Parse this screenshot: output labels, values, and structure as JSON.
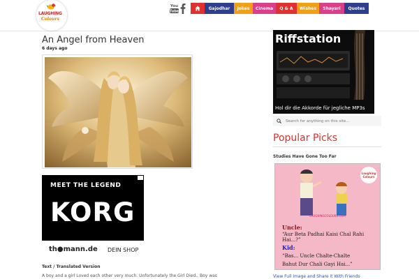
{
  "header": {
    "logo": {
      "line1": "LAUGHING",
      "line2": "Colours"
    },
    "social": [
      {
        "name": "youtube-icon",
        "text": "You Tube"
      },
      {
        "name": "facebook-icon",
        "text": "f"
      }
    ],
    "nav": [
      {
        "id": "home",
        "label": "",
        "color": "#e03030",
        "icon": "home-icon"
      },
      {
        "id": "gajodhar",
        "label": "Gajodhar",
        "color": "#2f3d8f"
      },
      {
        "id": "jokes",
        "label": "Jokes",
        "color": "#f0a016"
      },
      {
        "id": "cinema",
        "label": "Cinema",
        "color": "#d94088"
      },
      {
        "id": "qa",
        "label": "Q & A",
        "color": "#e03030"
      },
      {
        "id": "wishes",
        "label": "Wishes",
        "color": "#f0a016"
      },
      {
        "id": "shayari",
        "label": "Shayari",
        "color": "#d94088"
      },
      {
        "id": "quotes",
        "label": "Quotes",
        "color": "#2f3d8f"
      }
    ]
  },
  "post": {
    "title": "An Angel from Heaven",
    "date": "6 days ago",
    "section_label": "Text / Translated Version",
    "body_preview": "A boy and a girl Loved each other very much. Unfortunately the Girl Died.. Boy was"
  },
  "ad_korg": {
    "line1": "MEET THE LEGEND",
    "brand": "KORG",
    "store": "th●mann.de",
    "cta": "DEIN SHOP"
  },
  "ad_riff": {
    "title": "Riffstation",
    "subtitle": "Hol dir die Akkorde für jegliche MP3s"
  },
  "sidebar": {
    "search": {
      "placeholder": "Search for anything on this site..."
    },
    "popular_heading": "Popular Picks",
    "pick": {
      "title": "Studies Have Gone Too Far",
      "watermark": "LAUGHINGCOLOURS.COM",
      "badge": "Laughing Colours",
      "uncle_label": "Uncle:",
      "uncle_text": "“Aur Beta Padhai Kaisi Chal Rahi Hai...?”",
      "kid_label": "Kid:",
      "kid_text_1": "“Bas... Uncle Chalte-Chalte",
      "kid_text_2": "Bahut Dur Chali Gayi Hai...”",
      "link": "View Full Image and Share it With Friends"
    }
  }
}
